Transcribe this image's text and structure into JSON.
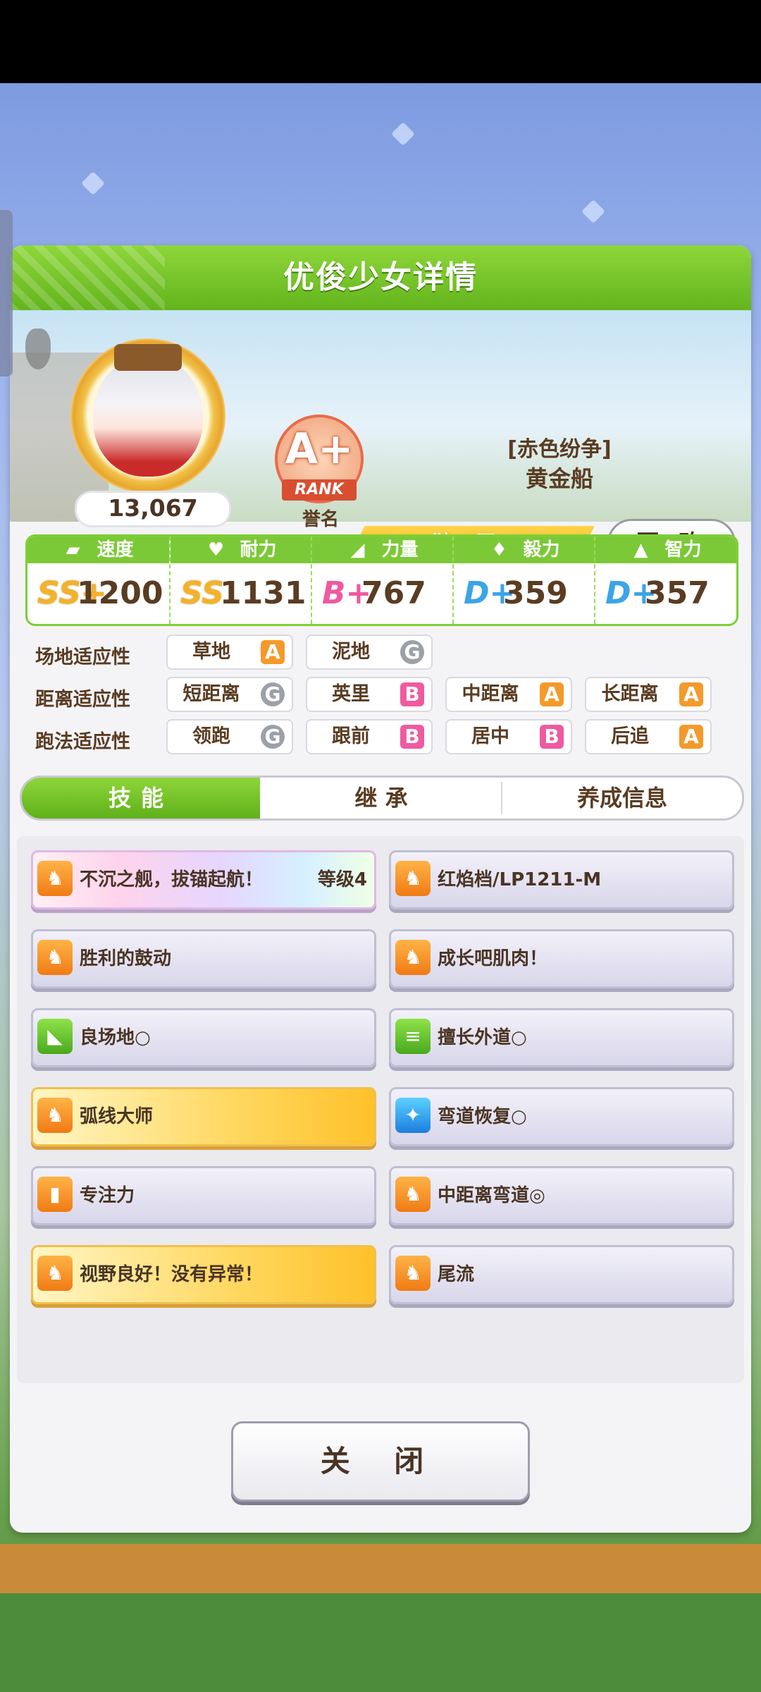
{
  "panel": {
    "title": "优俊少女详情"
  },
  "profile": {
    "score": "13,067",
    "rank_grade": "A+",
    "rank_label": "RANK",
    "honor_label": "誉名",
    "epithet": "[赤色纷争]",
    "name": "黄金船",
    "title": "独一无二",
    "change_button": "更 改"
  },
  "stats": [
    {
      "label": "速度",
      "grade": "SS+",
      "value": "1200",
      "icon": "shoe-icon",
      "grade_color": "#f3b22a"
    },
    {
      "label": "耐力",
      "grade": "SS",
      "value": "1131",
      "icon": "heart-icon",
      "grade_color": "#f3b22a"
    },
    {
      "label": "力量",
      "grade": "B+",
      "value": "767",
      "icon": "arm-icon",
      "grade_color": "#ef5aa0"
    },
    {
      "label": "毅力",
      "grade": "D+",
      "value": "359",
      "icon": "flame-icon",
      "grade_color": "#3ba5e6"
    },
    {
      "label": "智力",
      "grade": "D+",
      "value": "357",
      "icon": "graduation-cap-icon",
      "grade_color": "#3ba5e6"
    }
  ],
  "aptitude": {
    "track": {
      "label": "场地适应性",
      "items": [
        {
          "name": "草地",
          "rank": "A"
        },
        {
          "name": "泥地",
          "rank": "G"
        }
      ]
    },
    "distance": {
      "label": "距离适应性",
      "items": [
        {
          "name": "短距离",
          "rank": "G"
        },
        {
          "name": "英里",
          "rank": "B"
        },
        {
          "name": "中距离",
          "rank": "A"
        },
        {
          "name": "长距离",
          "rank": "A"
        }
      ]
    },
    "strategy": {
      "label": "跑法适应性",
      "items": [
        {
          "name": "领跑",
          "rank": "G"
        },
        {
          "name": "跟前",
          "rank": "B"
        },
        {
          "name": "居中",
          "rank": "B"
        },
        {
          "name": "后追",
          "rank": "A"
        }
      ]
    }
  },
  "tabs": [
    {
      "label": "技能",
      "active": true
    },
    {
      "label": "继 承",
      "active": false
    },
    {
      "label": "养成信息",
      "active": false
    }
  ],
  "skills": [
    {
      "label": "不沉之舰，拔锚起航！",
      "level": "等级4",
      "style": "rainbow",
      "icon": "horse-runner-icon"
    },
    {
      "label": "红焰档/LP1211-M",
      "style": "normal",
      "icon": "horse-runner-icon"
    },
    {
      "label": "胜利的鼓动",
      "style": "normal",
      "icon": "horse-runner-icon"
    },
    {
      "label": "成长吧肌肉！",
      "style": "normal",
      "icon": "horse-runner-icon"
    },
    {
      "label": "良场地○",
      "style": "normal",
      "icon": "muscle-arm-icon"
    },
    {
      "label": "擅长外道○",
      "style": "normal",
      "icon": "track-lanes-icon"
    },
    {
      "label": "弧线大师",
      "style": "gold",
      "icon": "horse-runner-icon"
    },
    {
      "label": "弯道恢复○",
      "style": "normal",
      "icon": "sparkle-icon"
    },
    {
      "label": "专注力",
      "style": "normal",
      "icon": "starting-gate-icon"
    },
    {
      "label": "中距离弯道◎",
      "style": "normal",
      "icon": "horse-runner-icon"
    },
    {
      "label": "视野良好！没有异常！",
      "style": "gold",
      "icon": "horse-runner-icon"
    },
    {
      "label": "尾流",
      "style": "normal",
      "icon": "horse-runner-icon"
    }
  ],
  "close_button": "关 闭"
}
